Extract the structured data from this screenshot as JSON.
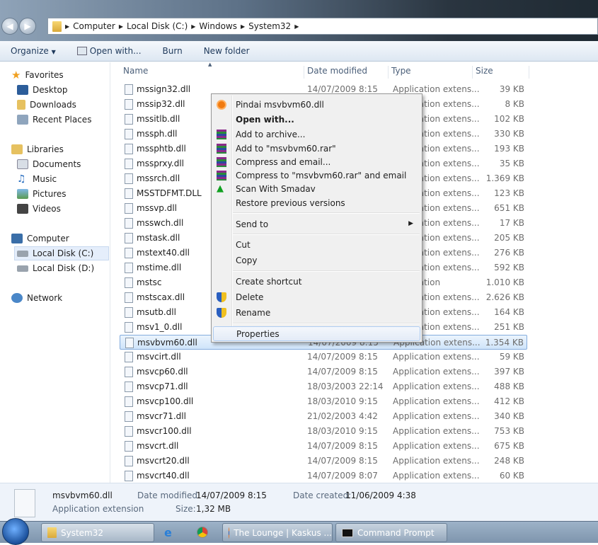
{
  "address": {
    "crumbs": [
      "Computer",
      "Local Disk (C:)",
      "Windows",
      "System32"
    ]
  },
  "toolbar": {
    "organize": "Organize",
    "open_with": "Open with...",
    "burn": "Burn",
    "new_folder": "New folder"
  },
  "sidebar": {
    "favorites": "Favorites",
    "desktop": "Desktop",
    "downloads": "Downloads",
    "recent": "Recent Places",
    "libraries": "Libraries",
    "documents": "Documents",
    "music": "Music",
    "pictures": "Pictures",
    "videos": "Videos",
    "computer": "Computer",
    "local_c": "Local Disk (C:)",
    "local_d": "Local Disk (D:)",
    "network": "Network"
  },
  "columns": {
    "name": "Name",
    "date": "Date modified",
    "type": "Type",
    "size": "Size"
  },
  "files": [
    {
      "name": "mssign32.dll",
      "date": "14/07/2009 8:15",
      "type": "Application extens...",
      "size": "39 KB"
    },
    {
      "name": "mssip32.dll",
      "date": "",
      "type": "Application extens...",
      "size": "8 KB"
    },
    {
      "name": "mssitlb.dll",
      "date": "",
      "type": "Application extens...",
      "size": "102 KB"
    },
    {
      "name": "mssph.dll",
      "date": "",
      "type": "Application extens...",
      "size": "330 KB"
    },
    {
      "name": "mssphtb.dll",
      "date": "",
      "type": "Application extens...",
      "size": "193 KB"
    },
    {
      "name": "mssprxy.dll",
      "date": "",
      "type": "Application extens...",
      "size": "35 KB"
    },
    {
      "name": "mssrch.dll",
      "date": "",
      "type": "Application extens...",
      "size": "1.369 KB"
    },
    {
      "name": "MSSTDFMT.DLL",
      "date": "",
      "type": "Application extens...",
      "size": "123 KB"
    },
    {
      "name": "mssvp.dll",
      "date": "",
      "type": "Application extens...",
      "size": "651 KB"
    },
    {
      "name": "msswch.dll",
      "date": "",
      "type": "Application extens...",
      "size": "17 KB"
    },
    {
      "name": "mstask.dll",
      "date": "",
      "type": "Application extens...",
      "size": "205 KB"
    },
    {
      "name": "mstext40.dll",
      "date": "",
      "type": "Application extens...",
      "size": "276 KB"
    },
    {
      "name": "mstime.dll",
      "date": "",
      "type": "Application extens...",
      "size": "592 KB"
    },
    {
      "name": "mstsc",
      "date": "",
      "type": "Application",
      "size": "1.010 KB"
    },
    {
      "name": "mstscax.dll",
      "date": "",
      "type": "Application extens...",
      "size": "2.626 KB"
    },
    {
      "name": "msutb.dll",
      "date": "",
      "type": "Application extens...",
      "size": "164 KB"
    },
    {
      "name": "msv1_0.dll",
      "date": "",
      "type": "Application extens...",
      "size": "251 KB"
    },
    {
      "name": "msvbvm60.dll",
      "date": "14/07/2009 8:15",
      "type": "Application extens...",
      "size": "1.354 KB",
      "selected": true
    },
    {
      "name": "msvcirt.dll",
      "date": "14/07/2009 8:15",
      "type": "Application extens...",
      "size": "59 KB"
    },
    {
      "name": "msvcp60.dll",
      "date": "14/07/2009 8:15",
      "type": "Application extens...",
      "size": "397 KB"
    },
    {
      "name": "msvcp71.dll",
      "date": "18/03/2003 22:14",
      "type": "Application extens...",
      "size": "488 KB"
    },
    {
      "name": "msvcp100.dll",
      "date": "18/03/2010 9:15",
      "type": "Application extens...",
      "size": "412 KB"
    },
    {
      "name": "msvcr71.dll",
      "date": "21/02/2003 4:42",
      "type": "Application extens...",
      "size": "340 KB"
    },
    {
      "name": "msvcr100.dll",
      "date": "18/03/2010 9:15",
      "type": "Application extens...",
      "size": "753 KB"
    },
    {
      "name": "msvcrt.dll",
      "date": "14/07/2009 8:15",
      "type": "Application extens...",
      "size": "675 KB"
    },
    {
      "name": "msvcrt20.dll",
      "date": "14/07/2009 8:15",
      "type": "Application extens...",
      "size": "248 KB"
    },
    {
      "name": "msvcrt40.dll",
      "date": "14/07/2009 8:07",
      "type": "Application extens...",
      "size": "60 KB"
    }
  ],
  "context_menu": {
    "pindai": "Pindai msvbvm60.dll",
    "open_with": "Open with...",
    "add_archive": "Add to archive...",
    "add_rar": "Add to \"msvbvm60.rar\"",
    "compress_email": "Compress and email...",
    "compress_rar_email": "Compress to \"msvbvm60.rar\" and email",
    "scan": "Scan With Smadav",
    "restore": "Restore previous versions",
    "send_to": "Send to",
    "cut": "Cut",
    "copy": "Copy",
    "create_shortcut": "Create shortcut",
    "delete": "Delete",
    "rename": "Rename",
    "properties": "Properties"
  },
  "details": {
    "name": "msvbvm60.dll",
    "type": "Application extension",
    "modified_label": "Date modified:",
    "modified": "14/07/2009 8:15",
    "created_label": "Date created:",
    "created": "11/06/2009 4:38",
    "size_label": "Size:",
    "size": "1,32 MB"
  },
  "taskbar": {
    "explorer": "System32",
    "firefox": "The Lounge | Kaskus ...",
    "cmd": "Command Prompt"
  }
}
